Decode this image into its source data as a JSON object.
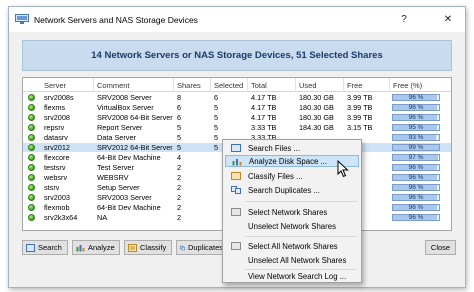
{
  "window": {
    "title": "Network Servers and NAS Storage Devices",
    "help_glyph": "?",
    "close_glyph": "✕"
  },
  "banner": "14 Network Servers or NAS Storage Devices, 51 Selected Shares",
  "columns": [
    "Server",
    "Comment",
    "Shares",
    "Selected",
    "Total",
    "Used",
    "Free",
    "Free (%)"
  ],
  "rows": [
    {
      "server": "srv2008s",
      "comment": "SRV2008 Server",
      "shares": "8",
      "selected": "6",
      "total": "4.17 TB",
      "used": "180.30 GB",
      "free": "3.99 TB",
      "free_pct": "96 %",
      "pct": 96
    },
    {
      "server": "flexms",
      "comment": "VirtualBox Server",
      "shares": "6",
      "selected": "5",
      "total": "4.17 TB",
      "used": "180.30 GB",
      "free": "3.99 TB",
      "free_pct": "96 %",
      "pct": 96
    },
    {
      "server": "srv2008",
      "comment": "SRV2008 64-Bit Server",
      "shares": "6",
      "selected": "5",
      "total": "4.17 TB",
      "used": "180.30 GB",
      "free": "3.99 TB",
      "free_pct": "96 %",
      "pct": 96
    },
    {
      "server": "repsrv",
      "comment": "Report Server",
      "shares": "5",
      "selected": "5",
      "total": "3.33 TB",
      "used": "184.30 GB",
      "free": "3.15 TB",
      "free_pct": "95 %",
      "pct": 95
    },
    {
      "server": "datasrv",
      "comment": "Data Server",
      "shares": "5",
      "selected": "5",
      "total": "3.33 TB",
      "used": "...",
      "free": "",
      "free_pct": "93 %",
      "pct": 93
    },
    {
      "server": "srv2012",
      "comment": "SRV2012 64-Bit Server",
      "shares": "5",
      "selected": "5",
      "total": "",
      "used": "",
      "free": "",
      "free_pct": "99 %",
      "pct": 99,
      "selected_row": true
    },
    {
      "server": "flexcore",
      "comment": "64-Bit Dev Machine",
      "shares": "4",
      "selected": "",
      "total": "",
      "used": "",
      "free": "",
      "free_pct": "97 %",
      "pct": 97
    },
    {
      "server": "testsrv",
      "comment": "Test Server",
      "shares": "2",
      "selected": "",
      "total": "",
      "used": "",
      "free": "",
      "free_pct": "96 %",
      "pct": 96
    },
    {
      "server": "websrv",
      "comment": "WEBSRV",
      "shares": "2",
      "selected": "",
      "total": "",
      "used": "",
      "free": "",
      "free_pct": "96 %",
      "pct": 96
    },
    {
      "server": "stsrv",
      "comment": "Setup Server",
      "shares": "2",
      "selected": "",
      "total": "",
      "used": "",
      "free": "",
      "free_pct": "96 %",
      "pct": 96
    },
    {
      "server": "srv2003",
      "comment": "SRV2003 Server",
      "shares": "2",
      "selected": "",
      "total": "",
      "used": "",
      "free": "",
      "free_pct": "96 %",
      "pct": 96
    },
    {
      "server": "flexmob",
      "comment": "64-Bit Dev Machine",
      "shares": "2",
      "selected": "",
      "total": "",
      "used": "",
      "free": "",
      "free_pct": "96 %",
      "pct": 96
    },
    {
      "server": "srv2k3x64",
      "comment": "NA",
      "shares": "2",
      "selected": "",
      "total": "",
      "used": "",
      "free": "",
      "free_pct": "96 %",
      "pct": 96
    }
  ],
  "buttons": {
    "search": "Search",
    "analyze": "Analyze",
    "classify": "Classify",
    "duplicates": "Duplicates",
    "close": "Close"
  },
  "menu": {
    "search_files": "Search Files ...",
    "analyze_disk_space": "Analyze Disk Space ...",
    "classify_files": "Classify Files ...",
    "search_duplicates": "Search Duplicates ...",
    "select_network_shares": "Select Network Shares",
    "unselect_network_shares": "Unselect Network Shares",
    "select_all_network_shares": "Select All Network Shares",
    "unselect_all_network_shares": "Unselect All Network Shares",
    "view_network_search_log": "View Network Search Log ..."
  },
  "colors": {
    "banner_bg": "#c8dbef",
    "banner_text": "#1d3b66",
    "selected_row": "#cfe3f7",
    "menu_hover": "#cde4f9",
    "status_green": "#3d9e1f"
  }
}
